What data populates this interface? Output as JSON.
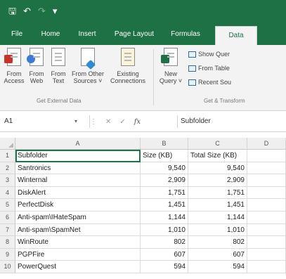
{
  "titlebar": {
    "icons": [
      "save-icon",
      "undo-icon",
      "redo-icon",
      "customize-qat-icon"
    ]
  },
  "tabs": [
    {
      "label": "File",
      "active": false
    },
    {
      "label": "Home",
      "active": false
    },
    {
      "label": "Insert",
      "active": false
    },
    {
      "label": "Page Layout",
      "active": false
    },
    {
      "label": "Formulas",
      "active": false
    },
    {
      "label": "Data",
      "active": true
    }
  ],
  "ribbon": {
    "get_external_data": {
      "group_label": "Get External Data",
      "buttons": [
        {
          "line1": "From",
          "line2": "Access",
          "icon": "access-db-icon"
        },
        {
          "line1": "From",
          "line2": "Web",
          "icon": "web-globe-icon"
        },
        {
          "line1": "From",
          "line2": "Text",
          "icon": "text-file-icon"
        },
        {
          "line1": "From Other",
          "line2": "Sources ˅",
          "icon": "other-sources-icon"
        },
        {
          "line1": "Existing",
          "line2": "Connections",
          "icon": "existing-connections-icon"
        }
      ]
    },
    "get_transform": {
      "group_label": "Get & Transform",
      "new_query": {
        "line1": "New",
        "line2": "Query ˅"
      },
      "items": [
        "Show Quer",
        "From Table",
        "Recent Sou"
      ]
    }
  },
  "formula_bar": {
    "name_box": "A1",
    "cancel_glyph": "✕",
    "enter_glyph": "✓",
    "fx_label": "fx",
    "value": "Subfolder"
  },
  "grid": {
    "columns": [
      "A",
      "B",
      "C",
      "D"
    ],
    "selected_cell": "A1",
    "rows": [
      {
        "num": "1",
        "a": "Subfolder",
        "b": "Size (KB)",
        "c": "Total Size (KB)"
      },
      {
        "num": "2",
        "a": "Santronics",
        "b": "9,540",
        "c": "9,540"
      },
      {
        "num": "3",
        "a": "Winternal",
        "b": "2,909",
        "c": "2,909"
      },
      {
        "num": "4",
        "a": "DiskAlert",
        "b": "1,751",
        "c": "1,751"
      },
      {
        "num": "5",
        "a": "PerfectDisk",
        "b": "1,451",
        "c": "1,451"
      },
      {
        "num": "6",
        "a": "Anti-spam\\IHateSpam",
        "b": "1,144",
        "c": "1,144"
      },
      {
        "num": "7",
        "a": "Anti-spam\\SpamNet",
        "b": "1,010",
        "c": "1,010"
      },
      {
        "num": "8",
        "a": "WinRoute",
        "b": "802",
        "c": "802"
      },
      {
        "num": "9",
        "a": "PGPFire",
        "b": "607",
        "c": "607"
      },
      {
        "num": "10",
        "a": "PowerQuest",
        "b": "594",
        "c": "594"
      }
    ]
  },
  "colors": {
    "excel_green": "#1e7145",
    "selection": "#217346"
  }
}
